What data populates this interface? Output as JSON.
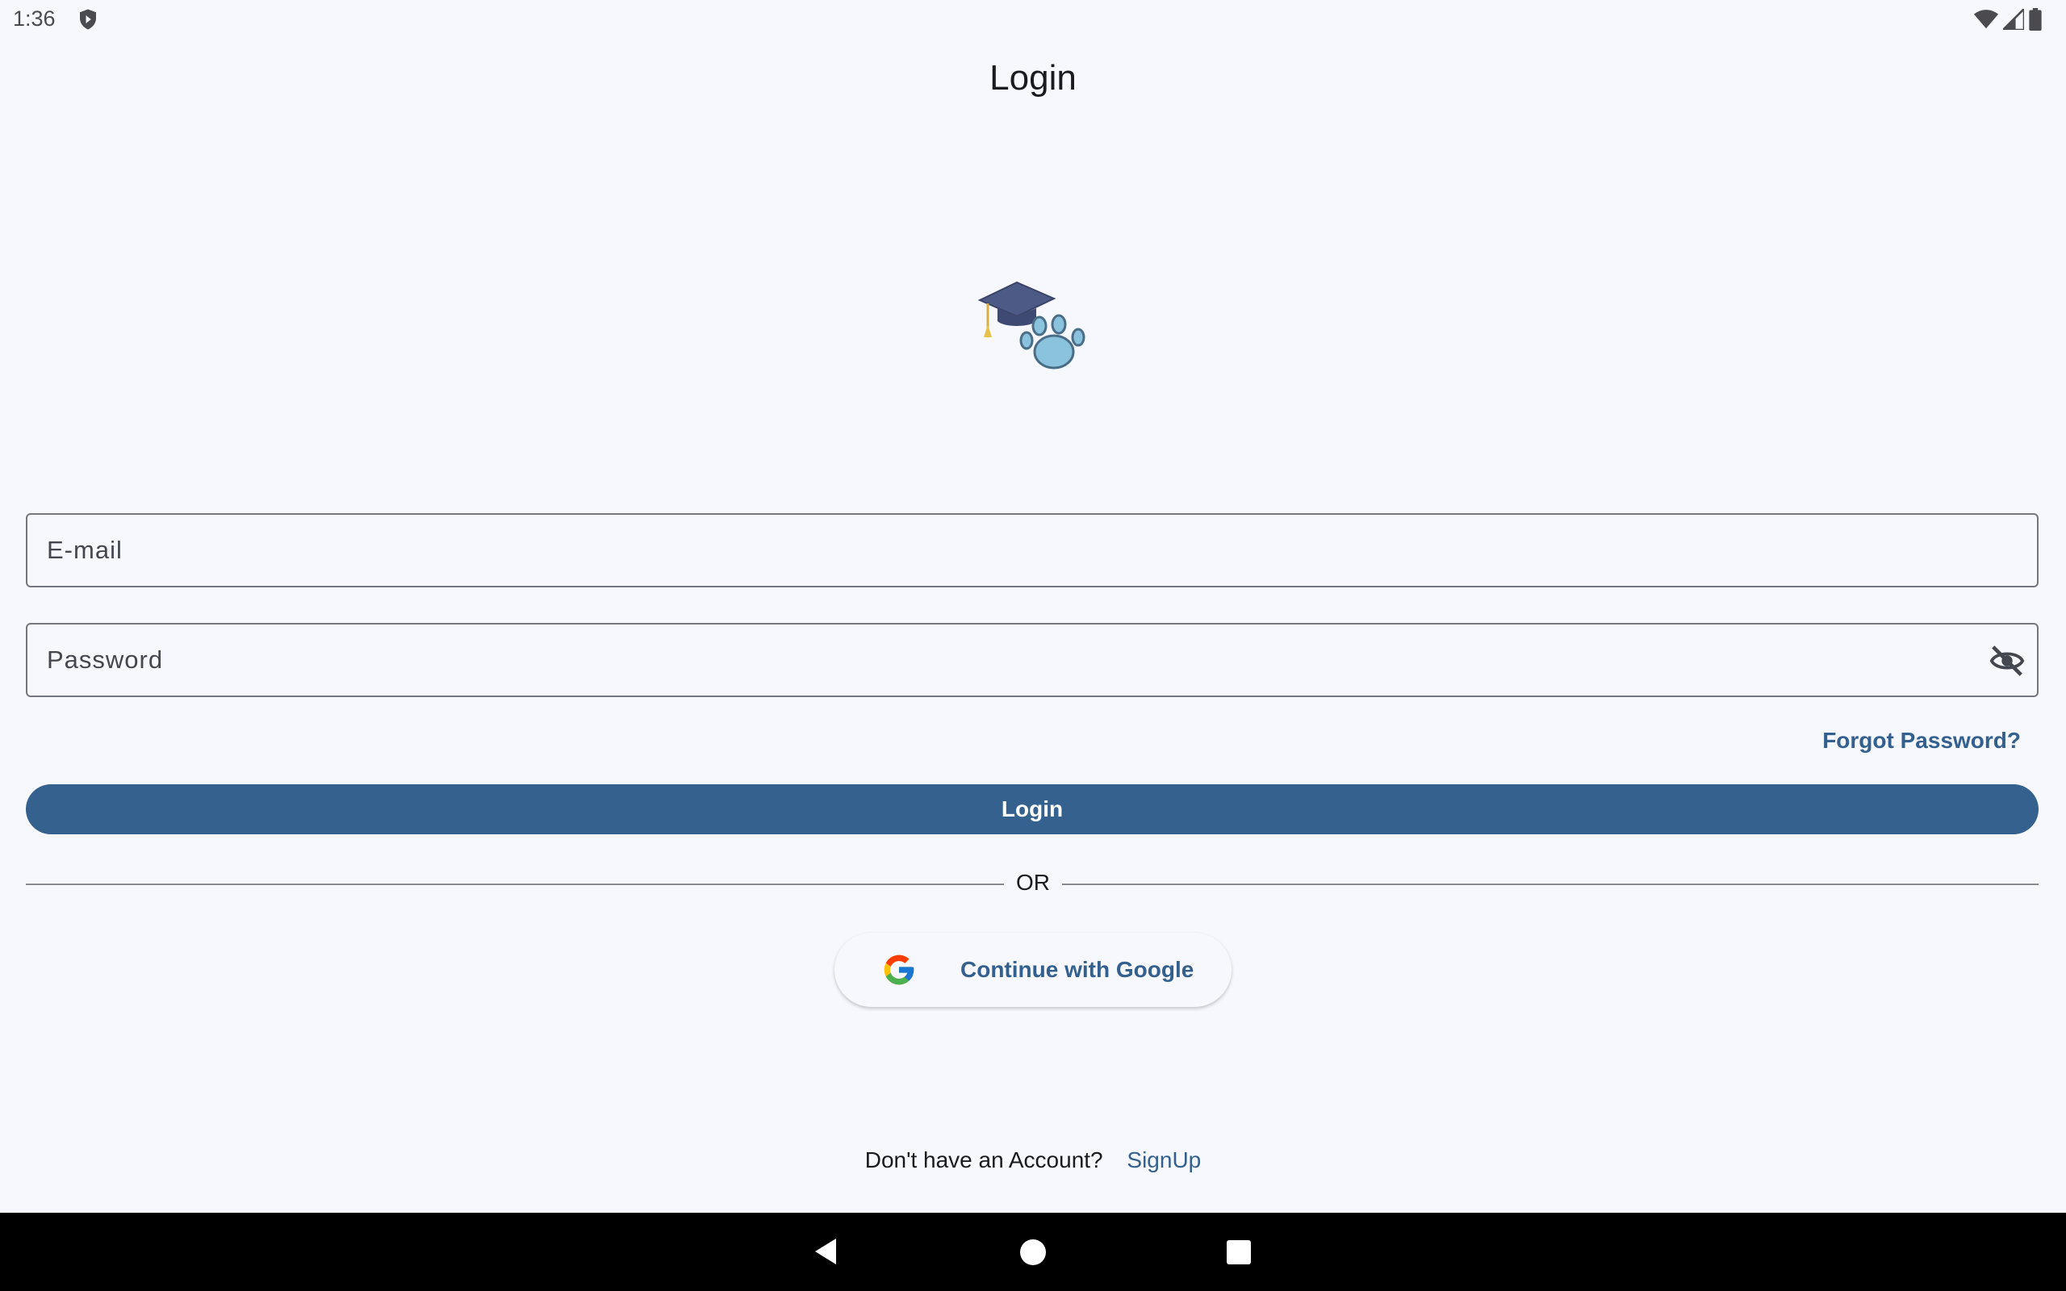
{
  "status_bar": {
    "time": "1:36",
    "icons": [
      "shield-icon",
      "wifi-icon",
      "cellular-signal-icon",
      "battery-icon"
    ]
  },
  "header": {
    "title": "Login"
  },
  "logo": {
    "icon": "graduation-cap-paw-logo"
  },
  "form": {
    "email_placeholder": "E-mail",
    "password_placeholder": "Password",
    "password_toggle_icon": "visibility-off-icon",
    "forgot_password": "Forgot Password?",
    "login_button": "Login",
    "or_divider": "OR",
    "google_button": "Continue with Google"
  },
  "footer": {
    "signup_prompt": "Don't have an Account?",
    "signup_link": "SignUp"
  },
  "nav_bar": {
    "icons": [
      "back-icon",
      "home-icon",
      "recents-icon"
    ]
  },
  "colors": {
    "background": "#f7f8fd",
    "primary": "#35618e",
    "link": "#33608f",
    "outline": "#74777f"
  }
}
